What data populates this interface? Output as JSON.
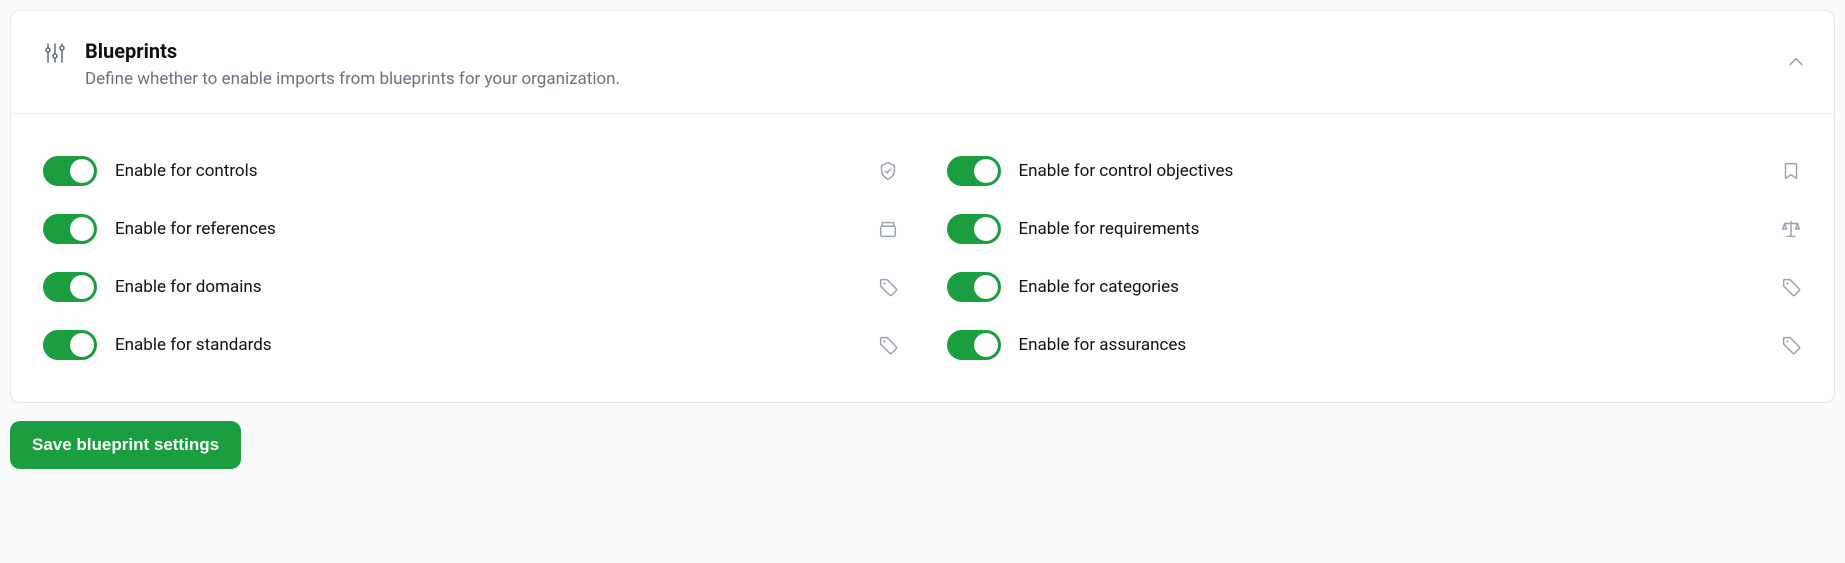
{
  "header": {
    "title": "Blueprints",
    "subtitle": "Define whether to enable imports from blueprints for your organization."
  },
  "settings": {
    "controls": {
      "label": "Enable for controls",
      "enabled": true
    },
    "control_objectives": {
      "label": "Enable for control objectives",
      "enabled": true
    },
    "references": {
      "label": "Enable for references",
      "enabled": true
    },
    "requirements": {
      "label": "Enable for requirements",
      "enabled": true
    },
    "domains": {
      "label": "Enable for domains",
      "enabled": true
    },
    "categories": {
      "label": "Enable for categories",
      "enabled": true
    },
    "standards": {
      "label": "Enable for standards",
      "enabled": true
    },
    "assurances": {
      "label": "Enable for assurances",
      "enabled": true
    }
  },
  "actions": {
    "save_label": "Save blueprint settings"
  },
  "colors": {
    "accent": "#1a9e3f"
  }
}
